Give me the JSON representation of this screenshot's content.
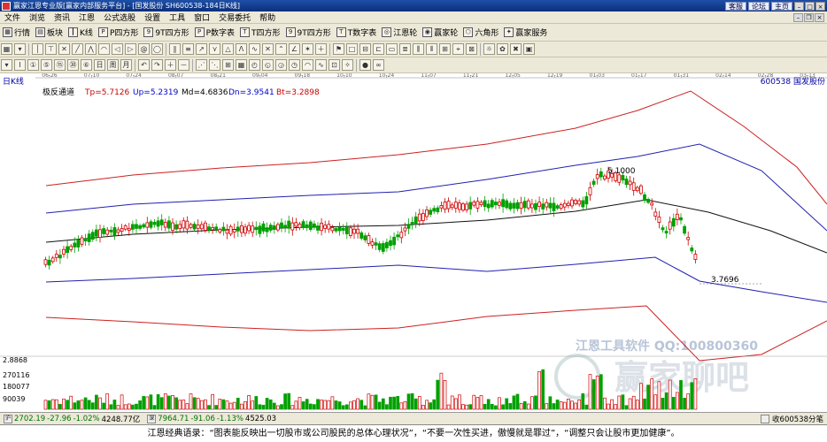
{
  "window": {
    "title": "赢家江恩专业版[赢家内部服务平台] - [国发股份 SH600538-184日K线]",
    "top_links": [
      "客服",
      "论坛",
      "主页"
    ]
  },
  "menu": [
    "文件",
    "浏览",
    "资讯",
    "江恩",
    "公式选股",
    "设置",
    "工具",
    "窗口",
    "交易委托",
    "帮助"
  ],
  "toolbar1": [
    "行情",
    "板块",
    "K线",
    "P四方形",
    "9T四方形",
    "P数字表",
    "T四方形",
    "9T四方形",
    "T数字表",
    "江恩轮",
    "赢家轮",
    "六角形",
    "赢家服务"
  ],
  "chart": {
    "period_label": "日K线",
    "stock_code_name": "600538 国发股份",
    "indicator": {
      "name": "极反通道",
      "tp_label": "Tp=5.7126",
      "up_label": "Up=5.2319",
      "md_label": "Md=4.6836",
      "dn_label": "Dn=3.9541",
      "bt_label": "Bt=3.2898"
    },
    "date_ticks": [
      "06-26",
      "07-10",
      "07-24",
      "08-07",
      "08-21",
      "09-04",
      "09-18",
      "10-10",
      "10-24",
      "11-07",
      "11-21",
      "12-05",
      "12-19",
      "01-03",
      "01-17",
      "01-31",
      "02-14",
      "02-28",
      "03-13"
    ],
    "high_marker": "5.1000",
    "low_marker": "3.7696",
    "volume_axis": [
      "2.8868",
      "270116",
      "180077",
      "90039"
    ],
    "watermark_tool": "江恩工具软件 QQ:100800360",
    "watermark_brand": "赢家聊吧",
    "colors": {
      "outer_band": "#cc2020",
      "inner_band": "#2020b0",
      "mid_line": "#101010",
      "up_candle": "#d00000",
      "down_candle": "#00a000"
    }
  },
  "status": {
    "sh": {
      "value": "2702.19",
      "change": "-27.96",
      "pct": "-1.02%",
      "amount": "4248.77亿"
    },
    "sz": {
      "value": "7964.71",
      "change": "-91.06",
      "pct": "-1.13%",
      "amount": "4525.03"
    },
    "right_text": "收600538分笔"
  },
  "footer_text": "江恩经典语录：“图表能反映出一切股市或公司股民的总体心理状况”，“不要一次性买进，傲慢就是罪过”，“调整只会让股市更加健康”。"
}
